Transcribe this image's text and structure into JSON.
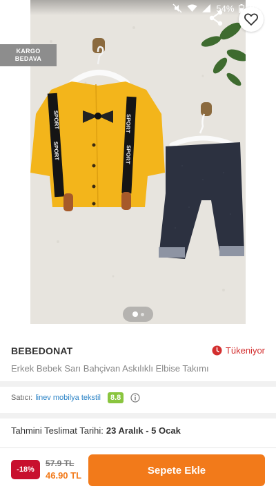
{
  "status_bar": {
    "battery": "54%",
    "time": "21:00"
  },
  "product": {
    "badge": "KARGO\nBEDAVA",
    "brand": "BEBEDONAT",
    "stock_status": "Tükeniyor",
    "name": "Erkek Bebek Sarı Bahçivan Askılıklı Elbise Takımı",
    "gallery": {
      "current": 1,
      "total": 2
    }
  },
  "seller": {
    "label": "Satıcı:",
    "name": "linev mobilya tekstil",
    "score": "8.8"
  },
  "delivery": {
    "label": "Tahmini Teslimat Tarihi:",
    "value": "23 Aralık - 5 Ocak"
  },
  "pricing": {
    "discount": "-18%",
    "old_price": "57.9 TL",
    "new_price": "46.90 TL"
  },
  "actions": {
    "add_to_cart": "Sepete Ekle"
  },
  "colors": {
    "accent": "#f27a1a",
    "discount": "#c8102e",
    "score": "#8ac53f",
    "link": "#2b83c6",
    "stock": "#d32f2f"
  }
}
